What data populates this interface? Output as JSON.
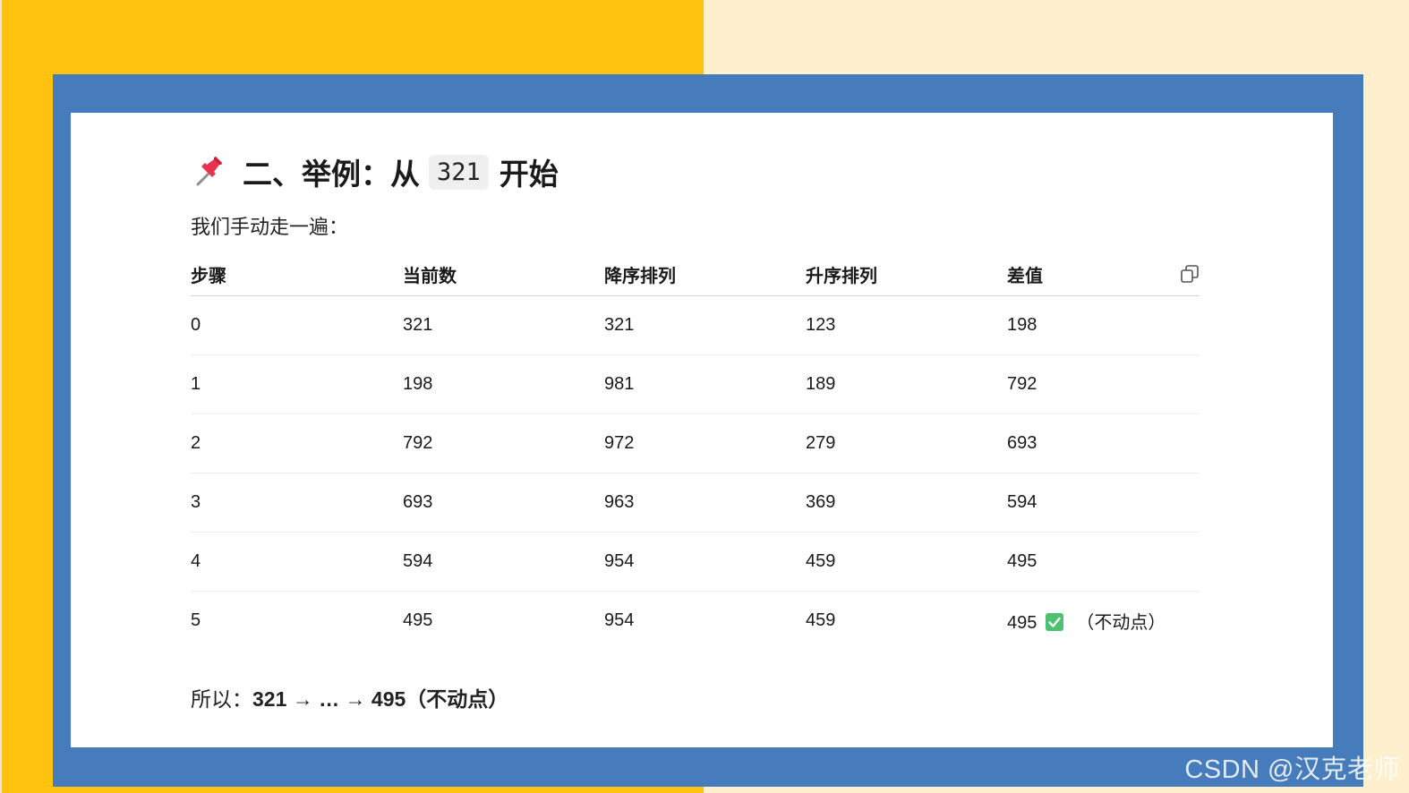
{
  "heading": {
    "prefix": "二、举例：从",
    "number": "321",
    "suffix": "开始",
    "icon": "pushpin-icon"
  },
  "intro": "我们手动走一遍：",
  "table": {
    "headers": [
      "步骤",
      "当前数",
      "降序排列",
      "升序排列",
      "差值"
    ],
    "rows": [
      [
        "0",
        "321",
        "321",
        "123",
        "198"
      ],
      [
        "1",
        "198",
        "981",
        "189",
        "792"
      ],
      [
        "2",
        "792",
        "972",
        "279",
        "693"
      ],
      [
        "3",
        "693",
        "963",
        "369",
        "594"
      ],
      [
        "4",
        "594",
        "954",
        "459",
        "495"
      ],
      [
        "5",
        "495",
        "954",
        "459",
        "495"
      ]
    ],
    "last_row_note": "（不动点）",
    "copy_icon": "copy-icon",
    "check_icon": "check-mark-icon",
    "check_color": "#4dc072"
  },
  "summary": {
    "prefix": "所以：",
    "bold": "321 → … → 495（不动点）"
  },
  "watermark": "CSDN @汉克老师",
  "colors": {
    "left_background": "#ffc20e",
    "right_background": "#fef0cc",
    "frame": "#477cbc",
    "card": "#ffffff"
  }
}
